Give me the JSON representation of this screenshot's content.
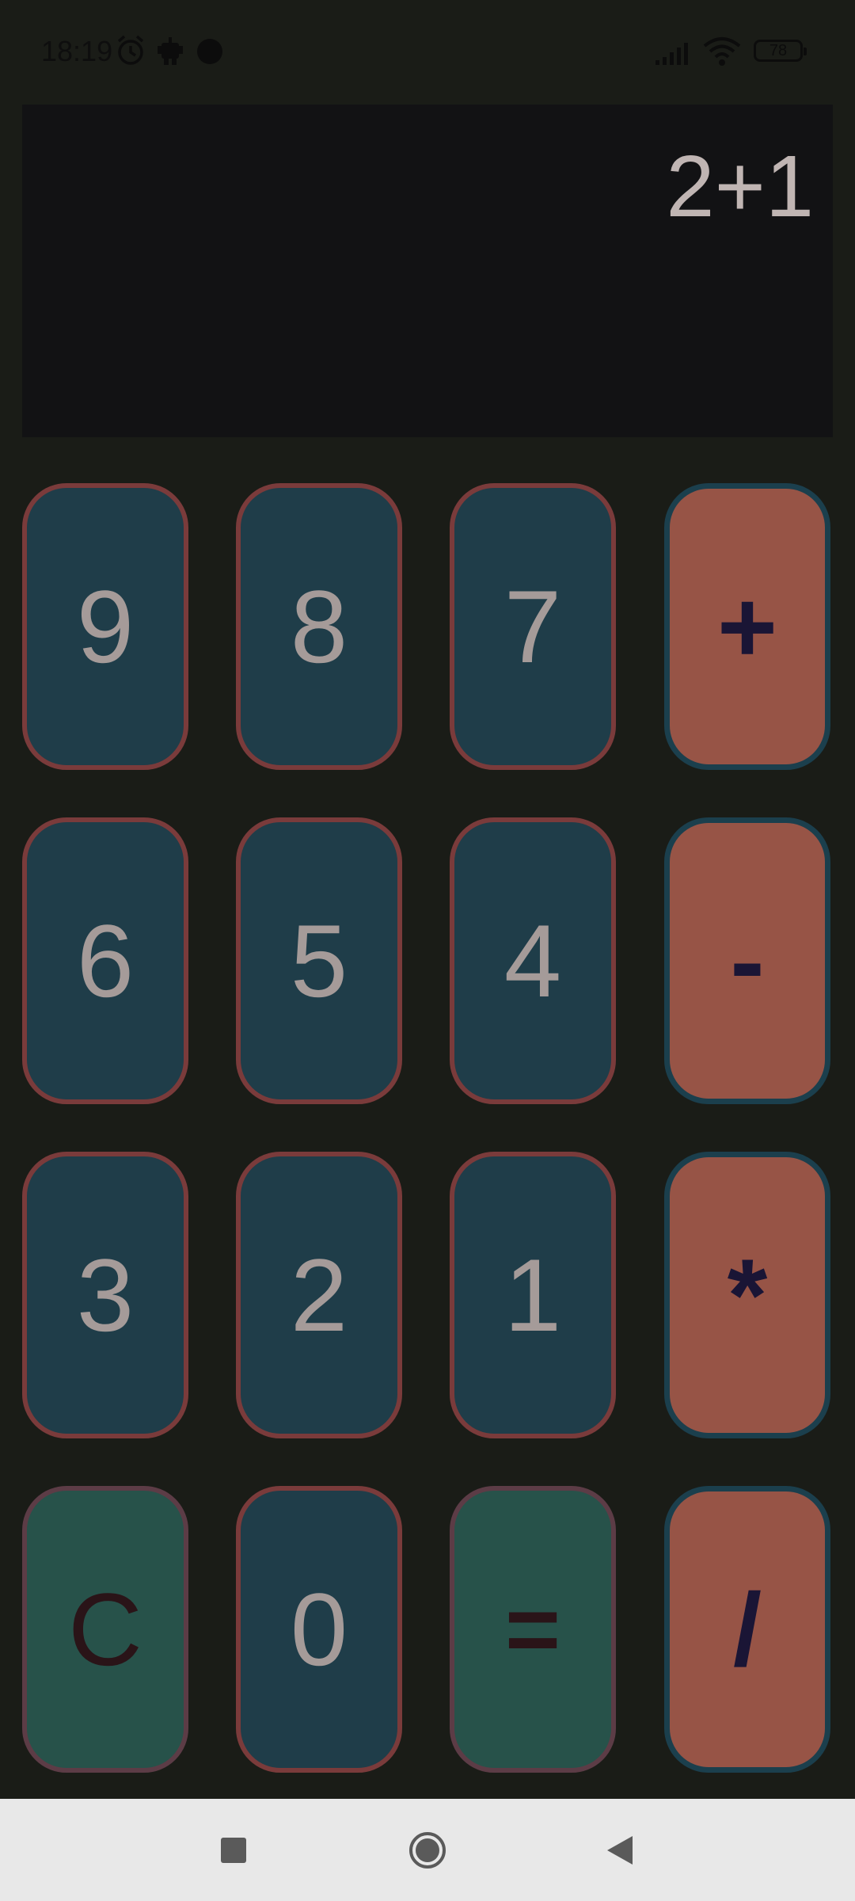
{
  "status_bar": {
    "time": "18:19",
    "battery_level": "78",
    "icons": [
      "alarm-icon",
      "robot-icon",
      "dot-icon",
      "signal-icon",
      "wifi-icon",
      "battery-icon"
    ]
  },
  "display": {
    "expression": "2+1"
  },
  "keypad": {
    "rows": [
      [
        {
          "label": "9",
          "kind": "num"
        },
        {
          "label": "8",
          "kind": "num"
        },
        {
          "label": "7",
          "kind": "num"
        },
        {
          "label": "+",
          "kind": "op"
        }
      ],
      [
        {
          "label": "6",
          "kind": "num"
        },
        {
          "label": "5",
          "kind": "num"
        },
        {
          "label": "4",
          "kind": "num"
        },
        {
          "label": "-",
          "kind": "op"
        }
      ],
      [
        {
          "label": "3",
          "kind": "num"
        },
        {
          "label": "2",
          "kind": "num"
        },
        {
          "label": "1",
          "kind": "num"
        },
        {
          "label": "*",
          "kind": "op"
        }
      ],
      [
        {
          "label": "C",
          "kind": "fn"
        },
        {
          "label": "0",
          "kind": "num"
        },
        {
          "label": "=",
          "kind": "fn"
        },
        {
          "label": "/",
          "kind": "op"
        }
      ]
    ]
  },
  "navigation": {
    "buttons": [
      "recents-icon",
      "home-icon",
      "back-icon"
    ]
  },
  "colors": {
    "background": "#1a1c17",
    "display_bg": "#121214",
    "number_key": "#1f3d49",
    "operator_key": "#975446",
    "function_key": "#27524a",
    "nav_bar": "#e8e8e8"
  }
}
